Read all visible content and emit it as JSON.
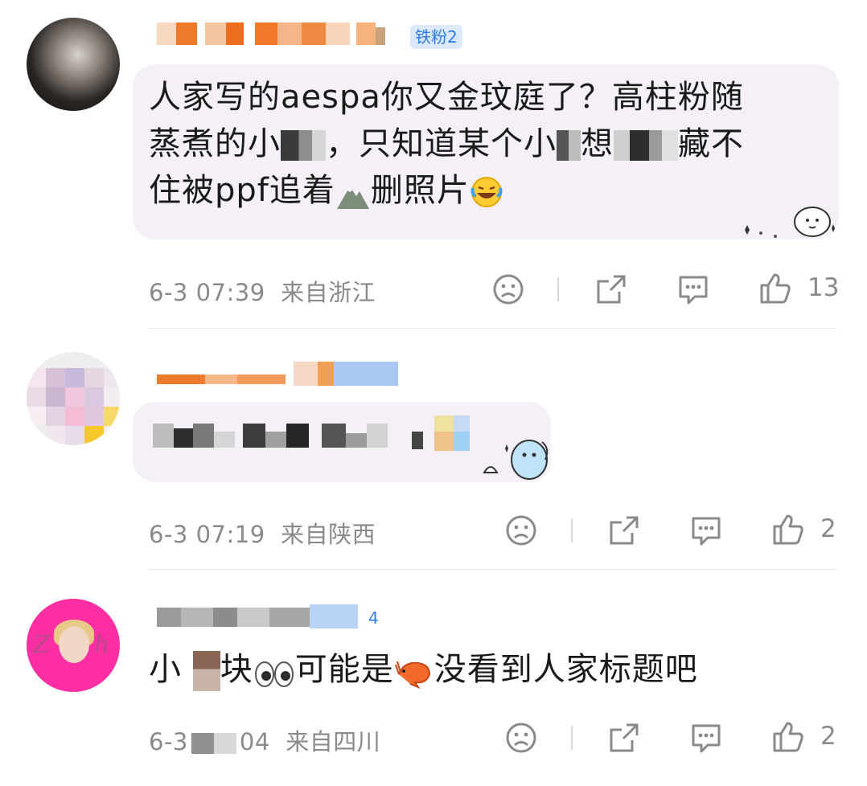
{
  "comments": [
    {
      "badge": "铁粉2",
      "text_line1": "人家写的aespa你又金玟庭了？高柱粉随",
      "text_line2a": "蒸煮的小",
      "text_line2b": "，只知道某个小",
      "text_line2c": "想",
      "text_line2d": "藏不",
      "text_line3a": "住被ppf追着",
      "text_line3b": "删照片",
      "time": "6-3 07:39",
      "location": "来自浙江",
      "likes": "13"
    },
    {
      "time": "6-3 07:19",
      "location": "来自陕西",
      "likes": "2"
    },
    {
      "badge": "4",
      "text_a": "小",
      "text_b": "块",
      "text_c": "可能是",
      "text_d": "没看到人家标题吧",
      "time_a": "6-3",
      "time_b": "04",
      "location": "来自四川",
      "likes": "2"
    }
  ],
  "icons": {
    "dislike": "sad-face-icon",
    "share": "share-icon",
    "reply": "comment-bubble-icon",
    "like": "thumbs-up-icon"
  },
  "colors": {
    "badge_bg": "#dbe9fb",
    "badge_text": "#2f7ae5",
    "nick_orange": "#f07a2a",
    "avatar_pink": "#ff2fa3"
  }
}
